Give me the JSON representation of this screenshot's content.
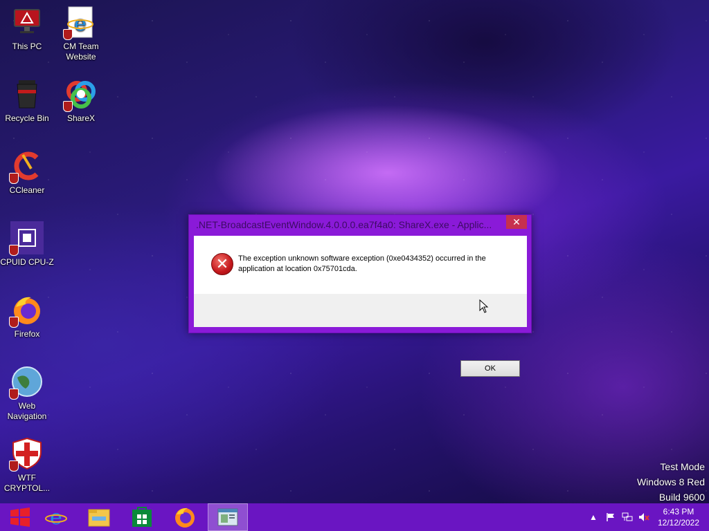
{
  "desktop": {
    "icons": [
      {
        "label": "This PC"
      },
      {
        "label": "CM Team Website"
      },
      {
        "label": "Recycle Bin"
      },
      {
        "label": "ShareX"
      },
      {
        "label": "CCleaner"
      },
      {
        "label": "CPUID CPU-Z"
      },
      {
        "label": "Firefox"
      },
      {
        "label": "Web Navigation"
      },
      {
        "label": "WTF CRYPTOL..."
      }
    ]
  },
  "dialog": {
    "title": ".NET-BroadcastEventWindow.4.0.0.0.ea7f4a0: ShareX.exe - Applic...",
    "close_label": "✕",
    "message": "The exception unknown software exception (0xe0434352) occurred in the application at location 0x75701cda.",
    "ok_label": "OK"
  },
  "watermark": {
    "line1": "Test Mode",
    "line2": "Windows 8 Red",
    "line3": "Build 9600"
  },
  "taskbar": {
    "items": [
      "start",
      "internet-explorer",
      "file-explorer",
      "store",
      "firefox",
      "active-window"
    ],
    "clock_time": "6:43 PM",
    "clock_date": "12/12/2022"
  },
  "colors": {
    "taskbar": "#6a15c2",
    "dialog_frame": "#8a1ad8",
    "close_button": "#c7304f"
  }
}
